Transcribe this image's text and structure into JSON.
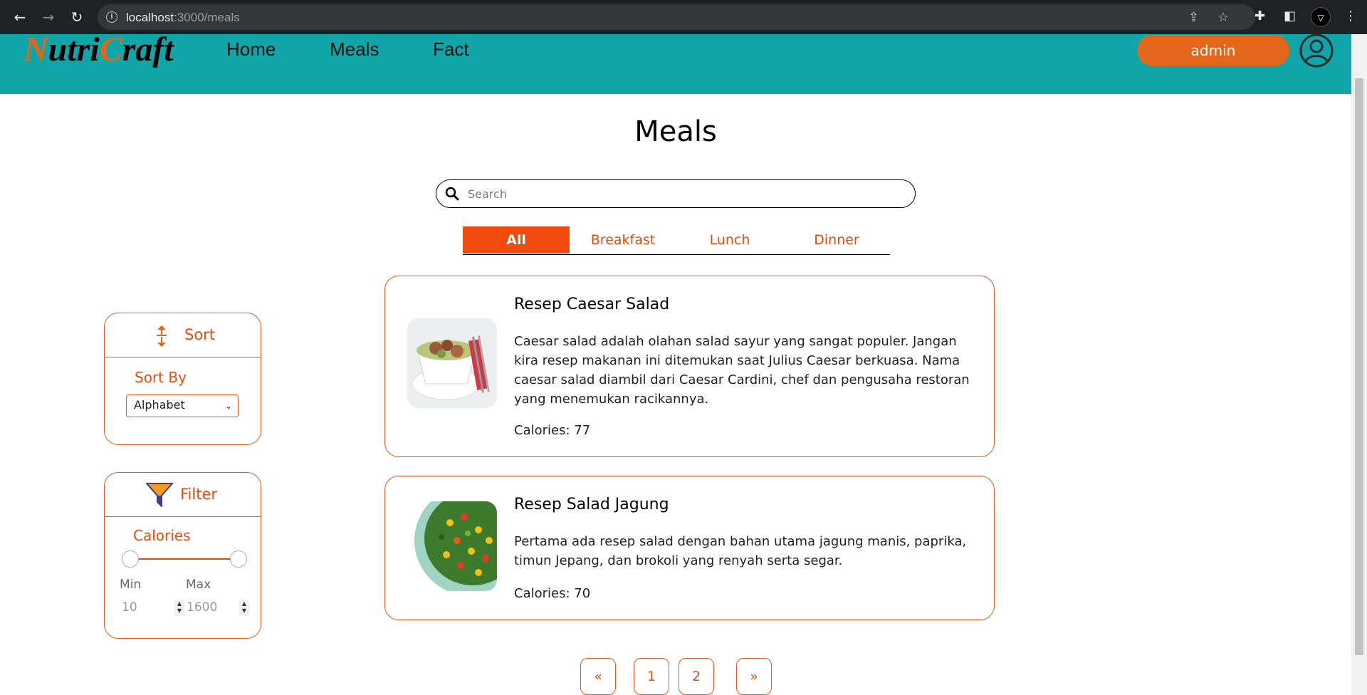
{
  "browser": {
    "url_host": "localhost",
    "url_path": ":3000/meals"
  },
  "header": {
    "logo_part1": "N",
    "logo_part2": "utri",
    "logo_part3": "C",
    "logo_part4": "raft",
    "nav": [
      "Home",
      "Meals",
      "Fact"
    ],
    "user_button": "admin"
  },
  "page": {
    "title": "Meals",
    "search_placeholder": "Search"
  },
  "tabs": [
    {
      "label": "All",
      "active": true
    },
    {
      "label": "Breakfast",
      "active": false
    },
    {
      "label": "Lunch",
      "active": false
    },
    {
      "label": "Dinner",
      "active": false
    }
  ],
  "sort": {
    "title": "Sort",
    "label": "Sort By",
    "selected": "Alphabet"
  },
  "filter": {
    "title": "Filter",
    "label": "Calories",
    "min_label": "Min",
    "max_label": "Max",
    "min_value": "10",
    "max_value": "1600"
  },
  "meals": [
    {
      "title": "Resep Caesar Salad",
      "description": "Caesar salad adalah olahan salad sayur yang sangat populer. Jangan kira resep makanan ini ditemukan saat Julius Caesar berkuasa. Nama caesar salad diambil dari Caesar Cardini, chef dan pengusaha restoran yang menemukan racikannya.",
      "calories": "Calories: 77"
    },
    {
      "title": "Resep Salad Jagung",
      "description": "Pertama ada resep salad dengan bahan utama jagung manis, paprika, timun Jepang, dan brokoli yang renyah serta segar.",
      "calories": "Calories: 70"
    }
  ],
  "pagination": {
    "prev": "«",
    "pages": [
      "1",
      "2"
    ],
    "next": "»"
  },
  "colors": {
    "header_bg": "#10a5a8",
    "accent": "#e3661b",
    "tab_active": "#f04a0f"
  }
}
